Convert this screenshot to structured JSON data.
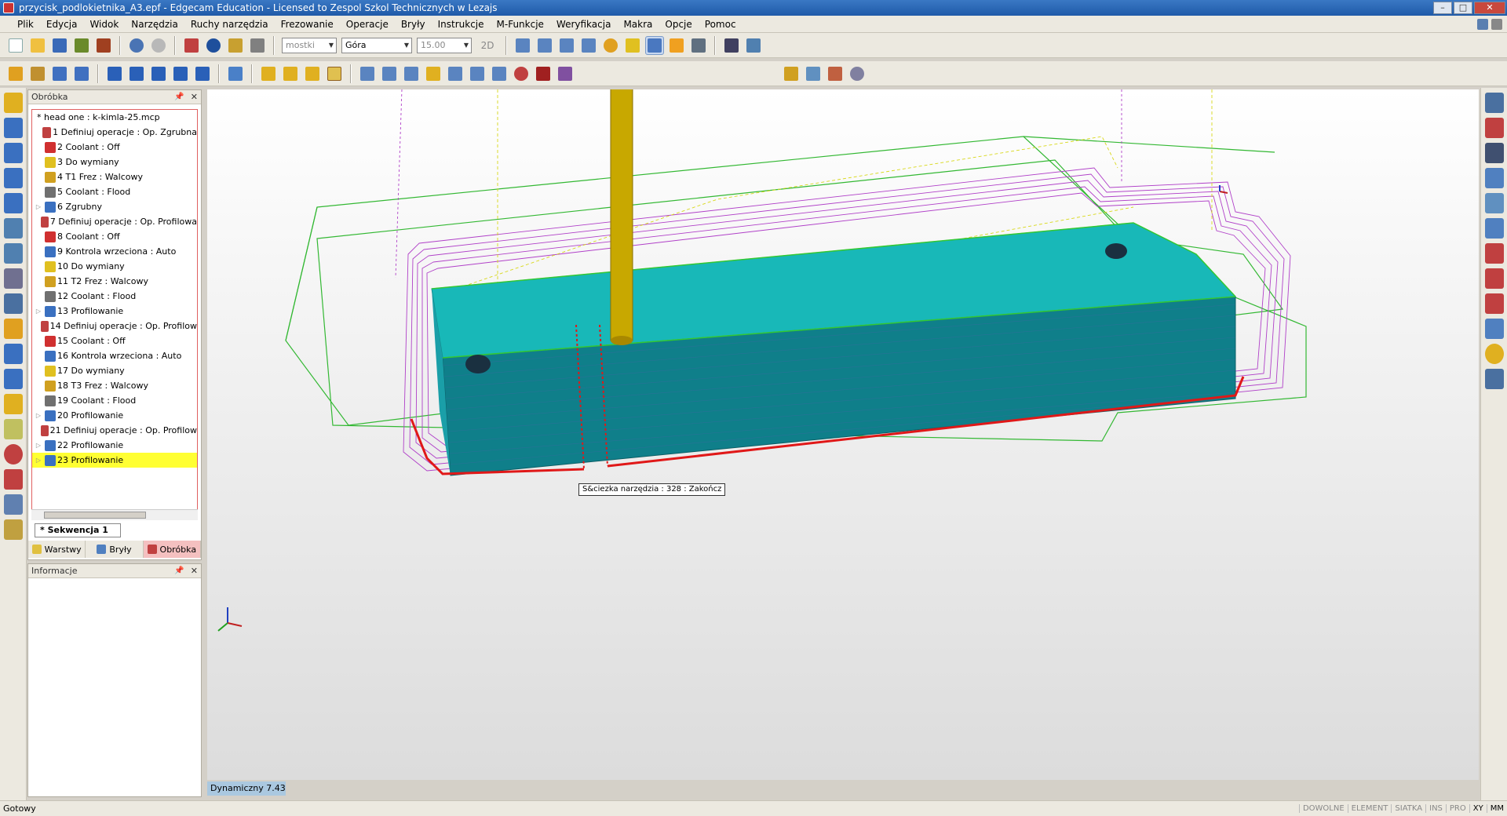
{
  "window": {
    "title": "przycisk_podlokietnika_A3.epf - Edgecam Education - Licensed to Zespol Szkol Technicznych w Lezajs"
  },
  "menu": [
    "Plik",
    "Edycja",
    "Widok",
    "Narzędzia",
    "Ruchy narzędzia",
    "Frezowanie",
    "Operacje",
    "Bryły",
    "Instrukcje",
    "M-Funkcje",
    "Weryfikacja",
    "Makra",
    "Opcje",
    "Pomoc"
  ],
  "toolbar": {
    "layer_combo": "mostki",
    "view_combo": "Góra",
    "value_combo": "15.00",
    "mode_label": "2D"
  },
  "panel": {
    "title": "Obróbka",
    "root": "* head one : k-kimla-25.mcp",
    "items": [
      {
        "label": "1 Definiuj operacje : Op. Zgrubna",
        "icon": "operation-icon"
      },
      {
        "label": "2 Coolant : Off",
        "icon": "coolant-off-icon"
      },
      {
        "label": "3 Do wymiany",
        "icon": "tool-change-icon"
      },
      {
        "label": "4 T1 Frez : Walcowy",
        "icon": "mill-tool-icon"
      },
      {
        "label": "5 Coolant : Flood",
        "icon": "coolant-flood-icon"
      },
      {
        "label": "6 Zgrubny",
        "icon": "roughing-icon"
      },
      {
        "label": "7 Definiuj operacje : Op. Profilowa",
        "icon": "operation-icon"
      },
      {
        "label": "8 Coolant : Off",
        "icon": "coolant-off-icon"
      },
      {
        "label": "9 Kontrola wrzeciona : Auto",
        "icon": "spindle-icon"
      },
      {
        "label": "10 Do wymiany",
        "icon": "tool-change-icon"
      },
      {
        "label": "11 T2 Frez : Walcowy",
        "icon": "mill-tool-icon"
      },
      {
        "label": "12 Coolant : Flood",
        "icon": "coolant-flood-icon"
      },
      {
        "label": "13 Profilowanie",
        "icon": "profiling-icon"
      },
      {
        "label": "14 Definiuj operacje : Op. Profilow",
        "icon": "operation-icon"
      },
      {
        "label": "15 Coolant : Off",
        "icon": "coolant-off-icon"
      },
      {
        "label": "16 Kontrola wrzeciona : Auto",
        "icon": "spindle-icon"
      },
      {
        "label": "17 Do wymiany",
        "icon": "tool-change-icon"
      },
      {
        "label": "18 T3 Frez : Walcowy",
        "icon": "mill-tool-icon"
      },
      {
        "label": "19 Coolant : Flood",
        "icon": "coolant-flood-icon"
      },
      {
        "label": "20 Profilowanie",
        "icon": "profiling-icon"
      },
      {
        "label": "21 Definiuj operacje : Op. Profilow",
        "icon": "operation-icon"
      },
      {
        "label": "22 Profilowanie",
        "icon": "profiling-icon"
      },
      {
        "label": "23 Profilowanie",
        "icon": "profiling-icon",
        "selected": true
      }
    ],
    "sequence_tab": "* Sekwencja 1",
    "tabs": [
      "Warstwy",
      "Bryły",
      "Obróbka"
    ]
  },
  "info_panel": {
    "title": "Informacje"
  },
  "viewport": {
    "tooltip": "S&ciezka narzędzia : 328 : Zakończ",
    "zoom_status": "Dynamiczny 7.43"
  },
  "status": {
    "left": "Gotowy",
    "flags": [
      "DOWOLNE",
      "ELEMENT",
      "SIATKA",
      "INS",
      "PRO",
      "XY",
      "MM"
    ]
  },
  "colors": {
    "selected": "#ffff33",
    "part": "#1fc8c8",
    "toolpath_magenta": "#b040c8",
    "toolpath_green": "#33b833",
    "toolpath_red": "#e01818",
    "toolpath_yellow": "#d8d818",
    "tool": "#c8a800"
  }
}
